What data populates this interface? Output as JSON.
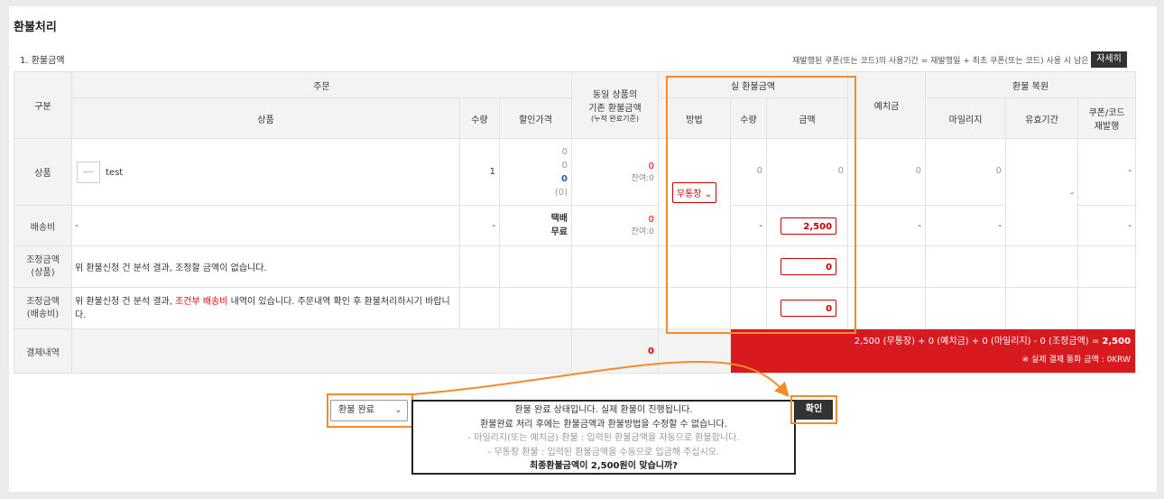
{
  "page": {
    "title": "환불처리",
    "subtitle": "1. 환불금액",
    "note": "재발행된 쿠폰(또는 코드)의 사용기간 = 재발행일 + 최초 쿠폰(또는 코드) 사용 시 남은 기간",
    "detail_button": "자세히"
  },
  "headers": {
    "category": "구분",
    "order": "주문",
    "same_item": "동일 상품의",
    "same_item_2": "기존 환불금액",
    "same_item_3": "(누적 완료기준)",
    "actual_refund": "실 환불금액",
    "deposit": "예치금",
    "restore": "환불 복원",
    "product": "상품",
    "qty": "수량",
    "discount_price": "할인가격",
    "method": "방법",
    "actual_qty": "수량",
    "amount": "금액",
    "mileage": "마일리지",
    "validity": "유효기간",
    "coupon_1": "쿠폰/코드",
    "coupon_2": "재발행"
  },
  "rows": {
    "product": {
      "label": "상품",
      "name": "test",
      "qty": "1",
      "price_lines": [
        "0",
        "0",
        "0",
        "(0)"
      ],
      "existing": "0",
      "existing_remain": "잔여:0",
      "method": "무통장",
      "actual_qty": "0",
      "amount": "0",
      "deposit": "0",
      "mileage": "0",
      "validity": "-",
      "coupon": "-"
    },
    "shipping": {
      "label": "배송비",
      "name": "-",
      "qty": "-",
      "price_line1": "택배",
      "price_line2": "무료",
      "existing": "0",
      "existing_remain": "잔여:0",
      "actual_qty": "-",
      "amount": "2,500",
      "deposit": "-",
      "mileage": "-",
      "coupon": "-"
    },
    "adjust_product": {
      "label_1": "조정금액",
      "label_2": "(상품)",
      "text": "위 환불신청 건 분석 결과, 조정할 금액이 없습니다.",
      "amount": "0"
    },
    "adjust_shipping": {
      "label_1": "조정금액",
      "label_2": "(배송비)",
      "text_before": "위 환불신청 건 분석 결과, ",
      "text_highlight": "조건부 배송비",
      "text_after": " 내역이 있습니다. 주문내역 확인 후 환불처리하시기 바랍니다.",
      "amount": "0"
    },
    "payment": {
      "label": "결제내역",
      "existing": "0",
      "summary": "2,500 (무통장) + 0 (예치금) + 0 (마일리지) - 0 (조정금액) = ",
      "summary_total": "2,500",
      "summary_note": "※ 실제 결제 통화 금액 : 0KRW"
    }
  },
  "footer": {
    "status_select": "환불 완료",
    "message_lines": [
      "환불 완료 상태입니다. 실제 환불이 진행됩니다.",
      "환불완료 처리 후에는 환불금액과 환불방법을 수정할 수 없습니다."
    ],
    "dim_lines": [
      "- 마일리지(또는 예치금) 환불 : 입력된 환불금액을 자동으로 환불합니다.",
      "- 무통장 환불 : 입력된 환불금액을 수동으로 입금해 주십시오."
    ],
    "confirm_line": "최종환불금액이 2,500원이 맞습니까?",
    "confirm_button": "확인"
  },
  "colors": {
    "highlight_orange": "#f38b2c",
    "summary_red": "#d71920",
    "accent_red": "#dd0000"
  }
}
